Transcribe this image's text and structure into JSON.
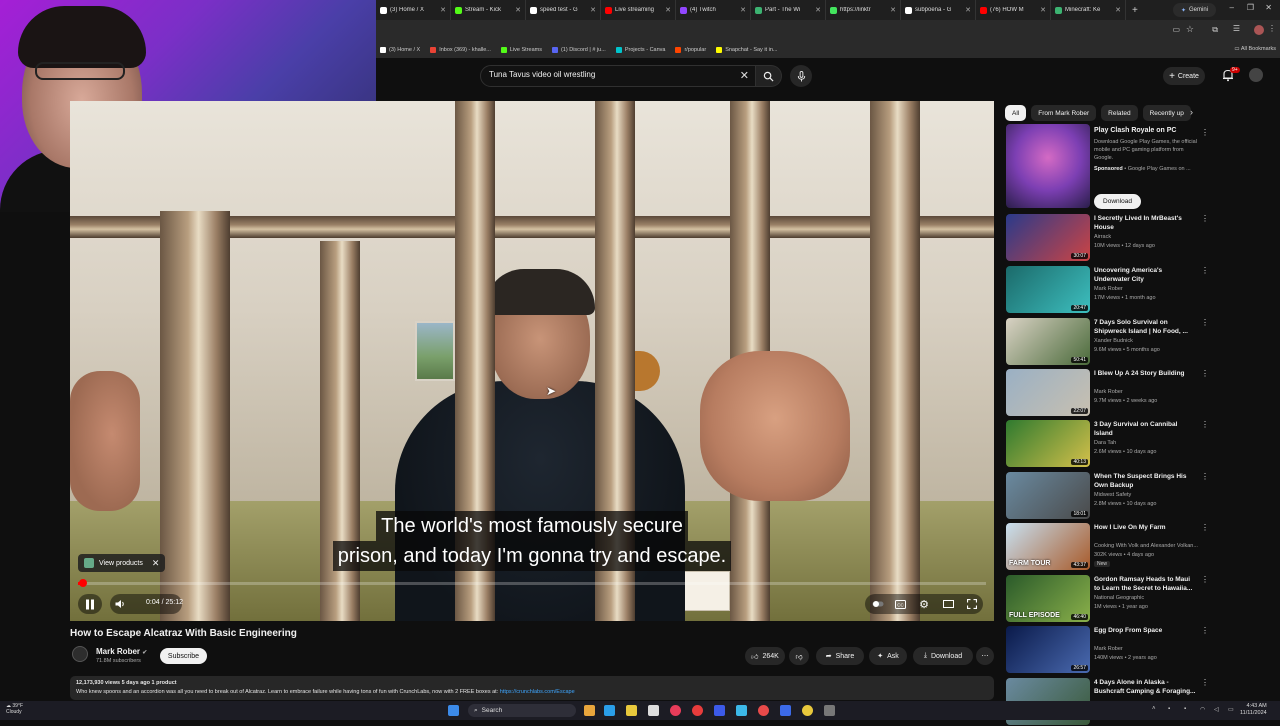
{
  "browser": {
    "tabs": [
      {
        "label": "(3) Home / X",
        "color": "#ffffff"
      },
      {
        "label": "Stream - Kick",
        "color": "#53fc18"
      },
      {
        "label": "speed test - G",
        "color": "#ffffff"
      },
      {
        "label": "Live streaming",
        "color": "#ff0000"
      },
      {
        "label": "(4) Twitch",
        "color": "#9146ff"
      },
      {
        "label": "Part - The Wi",
        "color": "#3cb371"
      },
      {
        "label": "https://linktr",
        "color": "#43e55e"
      },
      {
        "label": "subpoena - G",
        "color": "#ffffff"
      },
      {
        "label": "(76) HOW M",
        "color": "#ff0000"
      },
      {
        "label": "Minecraft: Ke",
        "color": "#3cb371"
      }
    ],
    "new_tab": "+",
    "gemini": "Gemini",
    "bookmarks": [
      {
        "label": "(3) Home / X",
        "color": "#ffffff"
      },
      {
        "label": "Inbox (369) - khalle...",
        "color": "#ea4335"
      },
      {
        "label": "Live Streams",
        "color": "#53fc18"
      },
      {
        "label": "(1) Discord | # ju...",
        "color": "#5865f2"
      },
      {
        "label": "Projects - Canva",
        "color": "#00c4cc"
      },
      {
        "label": "r/popular",
        "color": "#ff4500"
      },
      {
        "label": "Snapchat - Say it in...",
        "color": "#fffc00"
      }
    ],
    "all_bookmarks": "All Bookmarks"
  },
  "header": {
    "search_value": "Tuna Tavus video oil wrestling",
    "create_label": "Create",
    "notification_count": "9+"
  },
  "player": {
    "caption_line1": "The world's most famously secure",
    "caption_line2": "prison, and today I'm gonna try and escape.",
    "view_products": "View products",
    "time": "0:04 / 25:12",
    "progress_fraction": 0.003
  },
  "video": {
    "title": "How to Escape Alcatraz With Basic Engineering",
    "channel": "Mark Rober",
    "subscribers": "71.8M subscribers",
    "subscribe_label": "Subscribe",
    "likes": "264K",
    "share_label": "Share",
    "ask_label": "Ask",
    "download_label": "Download",
    "stats": "12,173,930 views  5 days ago  1 product",
    "description": "Who knew spoons and an accordion was all you need to break out of Alcatraz. Learn to embrace failure while having tons of fun with CrunchLabs, now with 2 FREE boxes at: ",
    "description_link": "https://crunchlabs.com/Escape"
  },
  "sidebar": {
    "chips": [
      "All",
      "From Mark Rober",
      "Related",
      "Recently up"
    ],
    "ad": {
      "title": "Play Clash Royale on PC",
      "desc": "Download Google Play Games, the official mobile and PC gaming platform from Google.",
      "sponsored": "Sponsored",
      "advertiser": "Google Play Games on ...",
      "download": "Download"
    },
    "recommendations": [
      {
        "title": "I Secretly Lived In MrBeast's House",
        "channel": "Airrack",
        "meta": "10M views • 12 days ago",
        "duration": "30:07",
        "colors": [
          "#2a3a8a",
          "#c44"
        ],
        "isNew": false
      },
      {
        "title": "Uncovering America's Underwater City",
        "channel": "Mark Rober",
        "meta": "17M views • 1 month ago",
        "duration": "20:47",
        "colors": [
          "#1b6a6a",
          "#3dbfbf"
        ],
        "isNew": false
      },
      {
        "title": "7 Days Solo Survival on Shipwreck Island | No Food, ...",
        "channel": "Xander Budnick",
        "meta": "9.6M views • 5 months ago",
        "duration": "50:41",
        "colors": [
          "#d9d2c4",
          "#4a6a3a"
        ],
        "isNew": false
      },
      {
        "title": "I Blew Up A 24 Story Building",
        "channel": "Mark Rober",
        "meta": "9.7M views • 2 weeks ago",
        "duration": "22:07",
        "colors": [
          "#9ab0c4",
          "#c8c0b0"
        ],
        "isNew": false
      },
      {
        "title": "3 Day Survival on Cannibal Island",
        "channel": "Dara Tah",
        "meta": "2.6M views • 10 days ago",
        "duration": "40:13",
        "colors": [
          "#2f7a2f",
          "#d4c04a"
        ],
        "isNew": false
      },
      {
        "title": "When The Suspect Brings His Own Backup",
        "channel": "Midwest Safety",
        "meta": "2.8M views • 10 days ago",
        "duration": "18:01",
        "colors": [
          "#6a8aa0",
          "#4a4a4a"
        ],
        "isNew": false
      },
      {
        "title": "How I Live On My Farm",
        "channel": "Cooking With Volk and Alexander Volkan...",
        "meta": "302K views • 4 days ago",
        "duration": "43:37",
        "colors": [
          "#c8e0f0",
          "#a85a2a"
        ],
        "isNew": true,
        "new_label": "New",
        "thumb_text": "FARM TOUR"
      },
      {
        "title": "Gordon Ramsay Heads to Maui to Learn the Secret to Hawaiia...",
        "channel": "National Geographic",
        "meta": "1M views • 1 year ago",
        "duration": "46:40",
        "colors": [
          "#2a5a2a",
          "#8ab04a"
        ],
        "isNew": false,
        "thumb_text": "FULL EPISODE"
      },
      {
        "title": "Egg Drop From Space",
        "channel": "Mark Rober",
        "meta": "140M views • 2 years ago",
        "duration": "26:57",
        "colors": [
          "#0a1a4a",
          "#4a6ab0"
        ],
        "isNew": false
      },
      {
        "title": "4 Days Alone in Alaska - Bushcraft Camping & Foraging...",
        "channel": "",
        "meta": "",
        "duration": "",
        "colors": [
          "#6a8aa0",
          "#3a5a3a"
        ],
        "isNew": false
      }
    ]
  },
  "taskbar": {
    "temp": "39°F",
    "weather": "Cloudy",
    "search": "Search",
    "time": "4:43 AM",
    "date": "11/11/2024"
  }
}
